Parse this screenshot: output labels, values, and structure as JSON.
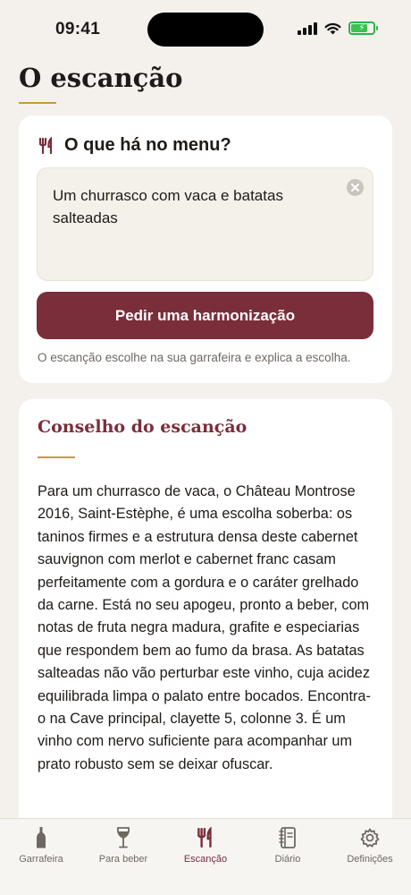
{
  "status_bar": {
    "time": "09:41"
  },
  "page": {
    "title": "O escanção"
  },
  "menu_card": {
    "title": "O que há no menu?",
    "input_value": "Um churrasco com vaca e batatas salteadas",
    "button_label": "Pedir uma harmonização",
    "hint": "O escanção escolhe na sua garrafeira e explica a escolha."
  },
  "advice_card": {
    "title": "Conselho do escanção",
    "text": "Para um churrasco de vaca, o Château Montrose 2016, Saint-Estèphe, é uma escolha soberba: os taninos firmes e a estrutura densa deste cabernet sauvignon com merlot e cabernet franc casam perfeitamente com a gordura e o caráter grelhado da carne. Está no seu apogeu, pronto a beber, com notas de fruta negra madura, grafite e especiarias que respondem bem ao fumo da brasa. As batatas salteadas não vão perturbar este vinho, cuja acidez equilibrada limpa o palato entre bocados. Encontra-o na Cave principal, clayette 5, colonne 3. É um vinho com nervo suficiente para acompanhar um prato robusto sem se deixar ofuscar."
  },
  "tabs": [
    {
      "label": "Garrafeira",
      "icon": "bottle-icon",
      "active": false
    },
    {
      "label": "Para beber",
      "icon": "wine-glass-icon",
      "active": false
    },
    {
      "label": "Escanção",
      "icon": "fork-knife-icon",
      "active": true
    },
    {
      "label": "Diário",
      "icon": "journal-icon",
      "active": false
    },
    {
      "label": "Definições",
      "icon": "gear-icon",
      "active": false
    }
  ],
  "colors": {
    "accent": "#7a2e3a",
    "gold": "#c99a3a",
    "background": "#f4f1ec",
    "battery": "#39c24f"
  }
}
